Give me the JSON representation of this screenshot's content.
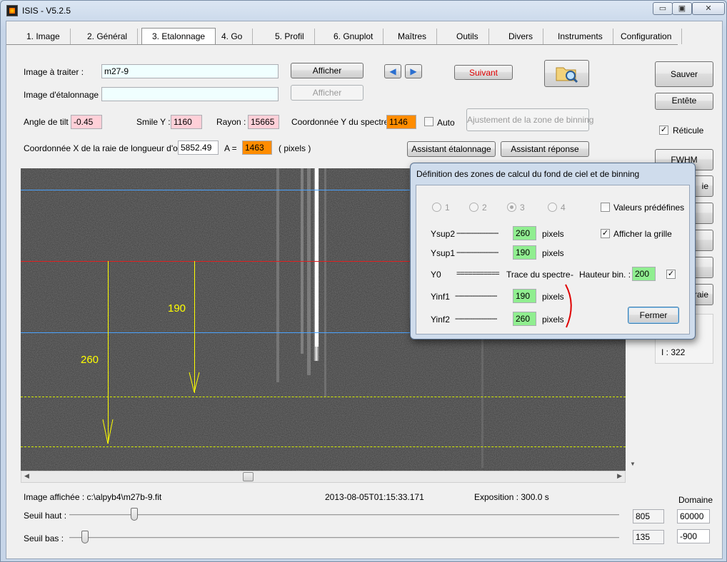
{
  "window": {
    "title": "ISIS - V5.2.5",
    "minimize": "▭",
    "maximize": "▣",
    "close": "✕"
  },
  "tabs": [
    "1. Image",
    "2. Général",
    "3. Etalonnage",
    "4. Go",
    "5. Profil",
    "6. Gnuplot",
    "Maîtres",
    "Outils",
    "Divers",
    "Instruments",
    "Configuration"
  ],
  "form": {
    "image_label": "Image à traiter :",
    "image_value": "m27-9",
    "calib_label": "Image d'étalonnage :",
    "calib_value": "",
    "show_btn": "Afficher",
    "show_btn2": "Afficher",
    "next_btn": "Suivant",
    "tilt_label": "Angle de tilt :",
    "tilt_value": "-0.45",
    "smile_label": "Smile Y :",
    "smile_value": "1160",
    "radius_label": "Rayon :",
    "radius_value": "15665",
    "spec_y_label": "Coordonnée Y du spectre :",
    "spec_y_value": "1146",
    "auto_label": "Auto",
    "binning_btn": "Ajustement de la zone de binning",
    "x_label": "Coordonnée X de la raie de longueur d'onde",
    "x_value": "5852.49",
    "a_label": "A  =",
    "a_value": "1463",
    "pixels_label": "( pixels )",
    "calib_assist_btn": "Assistant étalonnage",
    "response_assist_btn": "Assistant réponse"
  },
  "right_panel": {
    "save": "Sauver",
    "header": "Entête",
    "reticle": "Réticule",
    "fwhm": "FWHM",
    "partial_btn": "ie",
    "partial_btn2": "raie",
    "i_value": "I  : 322"
  },
  "viewer": {
    "label_190": "190",
    "label_260": "260"
  },
  "status": {
    "image_label": "Image affichée : c:\\alpyb4\\m27b-9.fit",
    "date": "2013-08-05T01:15:33.171",
    "exposure": "Exposition : 300.0 s"
  },
  "thresholds": {
    "domain_label": "Domaine",
    "high_label": "Seuil haut :",
    "high_value": "805",
    "high_domain": "60000",
    "low_label": "Seuil bas :",
    "low_value": "135",
    "low_domain": "-900",
    "high_fraction": 0.113,
    "low_fraction": 0.022
  },
  "dialog": {
    "title": "Définition des zones de calcul du fond de ciel et de binning",
    "radios": [
      "1",
      "2",
      "3",
      "4"
    ],
    "selected_radio": "3",
    "preset_label": "Valeurs prédéfines",
    "grid_label": "Afficher la grille",
    "ysup2": "Ysup2",
    "ysup2_value": "260",
    "ysup1": "Ysup1",
    "ysup1_value": "190",
    "y0": "Y0",
    "trace_label": "Trace du spectre",
    "height_label": "Hauteur bin. :",
    "height_value": "200",
    "yinf1": "Yinf1",
    "yinf1_value": "190",
    "yinf2": "Yinf2",
    "yinf2_value": "260",
    "pixels": "pixels",
    "close_btn": "Fermer"
  },
  "colors": {
    "pink": "#ffd0d8",
    "orange": "#ff8c00",
    "green": "#90ee90",
    "blue_line": "#4aa3ff",
    "red_line": "#e02020",
    "yellow": "#ffff00",
    "dash_yellow": "#d8f000",
    "red_bracket": "#e00000"
  }
}
